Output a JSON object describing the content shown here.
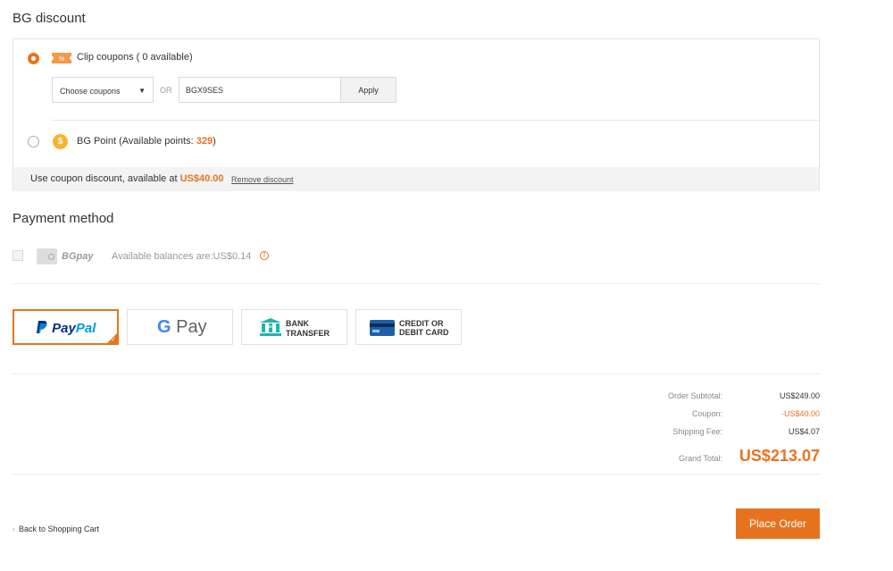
{
  "discount": {
    "title": "BG discount",
    "clip": {
      "label": "Clip coupons ( 0 available)",
      "select_label": "Choose coupons",
      "or_text": "OR",
      "code_value": "BGX9SES",
      "apply_label": "Apply"
    },
    "point": {
      "label_prefix": "BG Point (Available points: ",
      "points": "329",
      "label_suffix": ")"
    },
    "bar": {
      "text_prefix": "Use coupon discount, available at ",
      "amount": "US$40.00",
      "remove_label": "Remove discount"
    }
  },
  "payment": {
    "title": "Payment method",
    "bgpay": {
      "label": "BGpay",
      "balance": "Available balances are:US$0.14"
    },
    "methods": {
      "paypal": {
        "pay": "Pay",
        "pal": "Pal"
      },
      "gpay": {
        "g": "G",
        "pay": "Pay"
      },
      "bank": {
        "icon_text": "Bank",
        "line1": "BANK",
        "line2": "TRANSFER"
      },
      "card": {
        "line1": "CREDIT OR",
        "line2": "DEBIT CARD"
      }
    }
  },
  "summary": {
    "subtotal_label": "Order Subtotal:",
    "subtotal_value": "US$249.00",
    "coupon_label": "Coupon:",
    "coupon_value": "-US$40.00",
    "shipping_label": "Shipping Fee:",
    "shipping_value": "US$4.07",
    "total_label": "Grand Total:",
    "total_value": "US$213.07"
  },
  "footer": {
    "back_label": "Back to Shopping Cart",
    "place_order_label": "Place Order"
  },
  "colors": {
    "accent": "#e8731f"
  }
}
